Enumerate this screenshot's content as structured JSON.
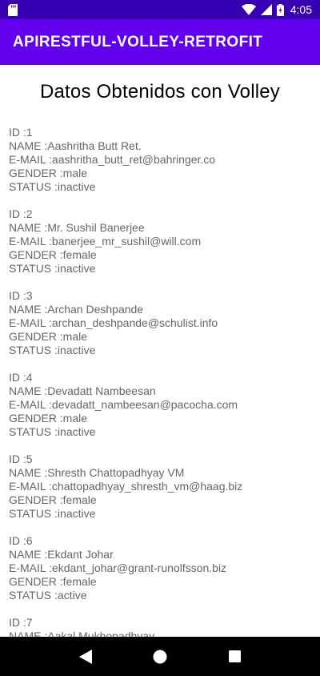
{
  "status_bar": {
    "time": "4:05",
    "icons": [
      "sd-card-icon",
      "wifi-icon",
      "signal-icon",
      "battery-icon"
    ]
  },
  "app_bar": {
    "title": "APIRESTFUL-VOLLEY-RETROFIT",
    "color": "#6200ee"
  },
  "main": {
    "heading": "Datos Obtenidos con Volley",
    "records": [
      {
        "id": "ID :1",
        "name": "NAME :Aashritha Butt Ret.",
        "email": "E-MAIL :aashritha_butt_ret@bahringer.co",
        "gender": "GENDER :male",
        "status": "STATUS :inactive"
      },
      {
        "id": "ID :2",
        "name": "NAME :Mr. Sushil Banerjee",
        "email": "E-MAIL :banerjee_mr_sushil@will.com",
        "gender": "GENDER :female",
        "status": "STATUS :inactive"
      },
      {
        "id": "ID :3",
        "name": "NAME :Archan Deshpande",
        "email": "E-MAIL :archan_deshpande@schulist.info",
        "gender": "GENDER :male",
        "status": "STATUS :inactive"
      },
      {
        "id": "ID :4",
        "name": "NAME :Devadatt Nambeesan",
        "email": "E-MAIL :devadatt_nambeesan@pacocha.com",
        "gender": "GENDER :male",
        "status": "STATUS :inactive"
      },
      {
        "id": "ID :5",
        "name": "NAME :Shresth Chattopadhyay VM",
        "email": "E-MAIL :chattopadhyay_shresth_vm@haag.biz",
        "gender": "GENDER :female",
        "status": "STATUS :inactive"
      },
      {
        "id": "ID :6",
        "name": "NAME :Ekdant Johar",
        "email": "E-MAIL :ekdant_johar@grant-runolfsson.biz",
        "gender": "GENDER :female",
        "status": "STATUS :active"
      },
      {
        "id": "ID :7",
        "name": "NAME :Aakal Mukhopadhyay",
        "email": "",
        "gender": "",
        "status": ""
      }
    ]
  },
  "nav_bar": {
    "buttons": [
      "back-icon",
      "home-icon",
      "recents-icon"
    ]
  }
}
